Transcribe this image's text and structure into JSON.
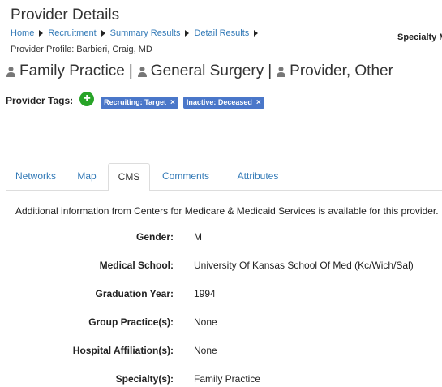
{
  "header": {
    "title": "Provider Details",
    "breadcrumb": [
      "Home",
      "Recruitment",
      "Summary Results",
      "Detail Results"
    ],
    "specialty_cut": "Specialty M",
    "profile_label": "Provider Profile: Barbieri, Craig, MD"
  },
  "specialties": [
    "Family Practice",
    "General Surgery",
    "Provider, Other"
  ],
  "tags": {
    "label": "Provider Tags:",
    "add_label": "+",
    "items": [
      "Recruiting: Target",
      "Inactive: Deceased"
    ],
    "remove_glyph": "×"
  },
  "tabs": {
    "items": [
      "Networks",
      "Map",
      "CMS",
      "Comments",
      "Attributes"
    ],
    "active": "CMS"
  },
  "cms": {
    "intro": "Additional information from Centers for Medicare & Medicaid Services is available for this provider.",
    "fields": [
      {
        "label": "Gender:",
        "value": "M"
      },
      {
        "label": "Medical School:",
        "value": "University Of Kansas School Of Med (Kc/Wich/Sal)"
      },
      {
        "label": "Graduation Year:",
        "value": "1994"
      },
      {
        "label": "Group Practice(s):",
        "value": "None"
      },
      {
        "label": "Hospital Affiliation(s):",
        "value": "None"
      },
      {
        "label": "Specialty(s):",
        "value": "Family Practice"
      }
    ]
  },
  "icons": {
    "breadcrumb_separator": "triangle-right-icon",
    "specialty": "person-icon",
    "add": "plus-circle-icon",
    "remove": "close-icon"
  },
  "colors": {
    "link": "#337ab7",
    "tag_bg": "#4a77c9",
    "add_button": "#28a428"
  }
}
